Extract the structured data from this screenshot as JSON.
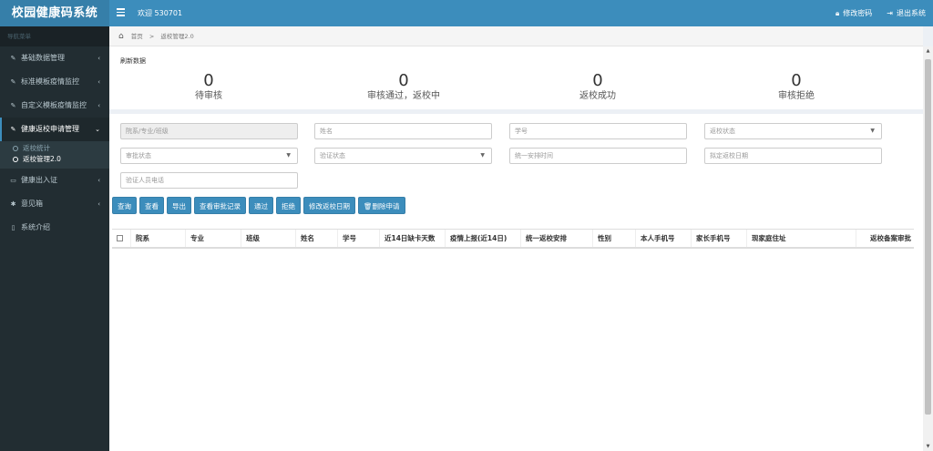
{
  "header": {
    "logo": "校园健康码系统",
    "welcome": "欢迎 530701",
    "change_password": "修改密码",
    "logout": "退出系统"
  },
  "sidebar": {
    "header": "导航菜单",
    "items": [
      {
        "label": "基础数据管理",
        "icon": "pen-icon"
      },
      {
        "label": "标准模板疫情监控",
        "icon": "pen-icon"
      },
      {
        "label": "自定义模板疫情监控",
        "icon": "pen-icon"
      },
      {
        "label": "健康返校申请管理",
        "icon": "pen-icon"
      },
      {
        "label": "健康出入证",
        "icon": "id-card-icon"
      },
      {
        "label": "意见箱",
        "icon": "gear-icon"
      },
      {
        "label": "系统介绍",
        "icon": "file-icon"
      }
    ],
    "submenu": [
      {
        "label": "返校统计"
      },
      {
        "label": "返校管理2.0"
      }
    ]
  },
  "breadcrumb": {
    "home": "首页",
    "current": "返校管理2.0"
  },
  "refresh_label": "刷新数据",
  "stats": [
    {
      "value": "0",
      "label": "待审核"
    },
    {
      "value": "0",
      "label": "审核通过，返校中"
    },
    {
      "value": "0",
      "label": "返校成功"
    },
    {
      "value": "0",
      "label": "审核拒绝"
    }
  ],
  "filters": {
    "dept": "院系/专业/班级",
    "name": "姓名",
    "student_id": "学号",
    "return_status": "返校状态",
    "approval_status": "审批状态",
    "verify_status": "验证状态",
    "schedule_time": "统一安排时间",
    "planned_date": "拟定返校日期",
    "verifier_phone": "验证人员电话"
  },
  "buttons": {
    "query": "查询",
    "view": "查看",
    "export": "导出",
    "view_records": "查看审批记录",
    "approve": "通过",
    "reject": "拒绝",
    "modify_date": "修改返校日期",
    "delete": "删除申请"
  },
  "table": {
    "columns": [
      "院系",
      "专业",
      "班级",
      "姓名",
      "学号",
      "近14日缺卡天数",
      "疫情上报(近14日)",
      "统一返校安排",
      "性别",
      "本人手机号",
      "家长手机号",
      "现家庭住址",
      "返校备案审批"
    ]
  }
}
